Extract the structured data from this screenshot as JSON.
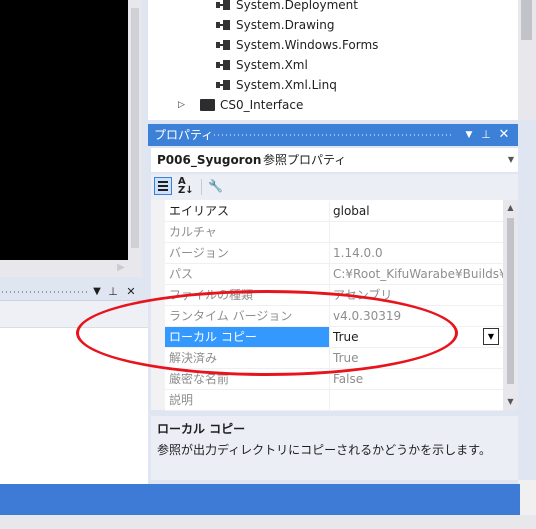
{
  "solution_tree": {
    "references": [
      "System.Deployment",
      "System.Drawing",
      "System.Windows.Forms",
      "System.Xml",
      "System.Xml.Linq"
    ],
    "project": "CS0_Interface"
  },
  "properties": {
    "title": "プロパティ",
    "object_name": "P006_Syugoron",
    "object_type": "参照プロパティ",
    "rows": [
      {
        "name": "エイリアス",
        "value": "global"
      },
      {
        "name": "カルチャ",
        "value": ""
      },
      {
        "name": "バージョン",
        "value": "1.14.0.0"
      },
      {
        "name": "パス",
        "value": "C:¥Root_KifuWarabe¥Builds¥"
      },
      {
        "name": "ファイルの種類",
        "value": "アセンブリ"
      },
      {
        "name": "ランタイム バージョン",
        "value": "v4.0.30319"
      },
      {
        "name": "ローカル コピー",
        "value": "True"
      },
      {
        "name": "解決済み",
        "value": "True"
      },
      {
        "name": "厳密な名前",
        "value": "False"
      },
      {
        "name": "説明",
        "value": ""
      }
    ],
    "description_title": "ローカル コピー",
    "description_text": "参照が出力ディレクトリにコピーされるかどうかを示します。"
  },
  "colors": {
    "accent": "#3d80d7",
    "selection": "#3399ff",
    "annotation": "#e8141c"
  }
}
